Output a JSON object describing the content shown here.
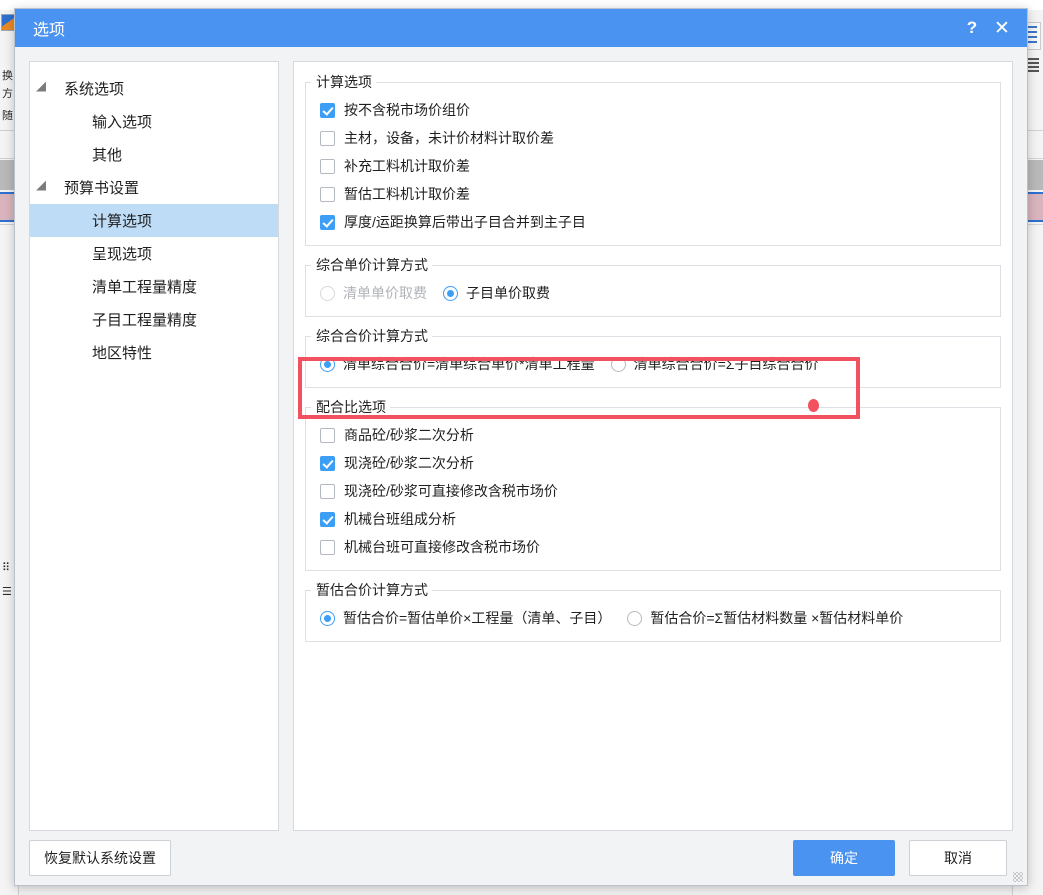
{
  "dialog": {
    "title": "选项",
    "help_label": "?",
    "close_label": "✕"
  },
  "sidebar": {
    "items": [
      {
        "label": "系统选项",
        "type": "group",
        "selected": false
      },
      {
        "label": "输入选项",
        "type": "leaf",
        "selected": false
      },
      {
        "label": "其他",
        "type": "leaf",
        "selected": false
      },
      {
        "label": "预算书设置",
        "type": "group",
        "selected": false
      },
      {
        "label": "计算选项",
        "type": "leaf",
        "selected": true
      },
      {
        "label": "呈现选项",
        "type": "leaf",
        "selected": false
      },
      {
        "label": "清单工程量精度",
        "type": "leaf",
        "selected": false
      },
      {
        "label": "子目工程量精度",
        "type": "leaf",
        "selected": false
      },
      {
        "label": "地区特性",
        "type": "leaf",
        "selected": false
      }
    ]
  },
  "groups": {
    "calc_options": {
      "legend": "计算选项",
      "items": [
        {
          "label": "按不含税市场价组价",
          "checked": true
        },
        {
          "label": "主材，设备，未计价材料计取价差",
          "checked": false
        },
        {
          "label": "补充工料机计取价差",
          "checked": false
        },
        {
          "label": "暂估工料机计取价差",
          "checked": false
        },
        {
          "label": "厚度/运距换算后带出子目合并到主子目",
          "checked": true
        }
      ]
    },
    "unit_price_method": {
      "legend": "综合单价计算方式",
      "items": [
        {
          "label": "清单单价取费",
          "selected": false,
          "disabled": true
        },
        {
          "label": "子目单价取费",
          "selected": true,
          "disabled": false
        }
      ]
    },
    "total_price_method": {
      "legend": "综合合价计算方式",
      "items": [
        {
          "label": "清单综合合价=清单综合单价*清单工程量",
          "selected": true,
          "disabled": false
        },
        {
          "label": "清单综合合价=Σ子目综合合价",
          "selected": false,
          "disabled": false
        }
      ]
    },
    "mix_ratio_options": {
      "legend": "配合比选项",
      "items": [
        {
          "label": "商品砼/砂浆二次分析",
          "checked": false
        },
        {
          "label": "现浇砼/砂浆二次分析",
          "checked": true
        },
        {
          "label": "现浇砼/砂浆可直接修改含税市场价",
          "checked": false
        },
        {
          "label": "机械台班组成分析",
          "checked": true
        },
        {
          "label": "机械台班可直接修改含税市场价",
          "checked": false
        }
      ]
    },
    "provisional_price_method": {
      "legend": "暂估合价计算方式",
      "items": [
        {
          "label": "暂估合价=暂估单价×工程量（清单、子目）",
          "selected": true,
          "disabled": false
        },
        {
          "label": "暂估合价=Σ暂估材料数量 ×暂估材料单价",
          "selected": false,
          "disabled": false
        }
      ]
    }
  },
  "footer": {
    "reset_label": "恢复默认系统设置",
    "ok_label": "确定",
    "cancel_label": "取消"
  },
  "annotation": {
    "highlight_target": "综合合价计算方式",
    "color": "#f2515f"
  },
  "background_app": {
    "left_rail_text": [
      "换",
      "方",
      "随"
    ],
    "right_rail_icon": "menu-icon"
  }
}
